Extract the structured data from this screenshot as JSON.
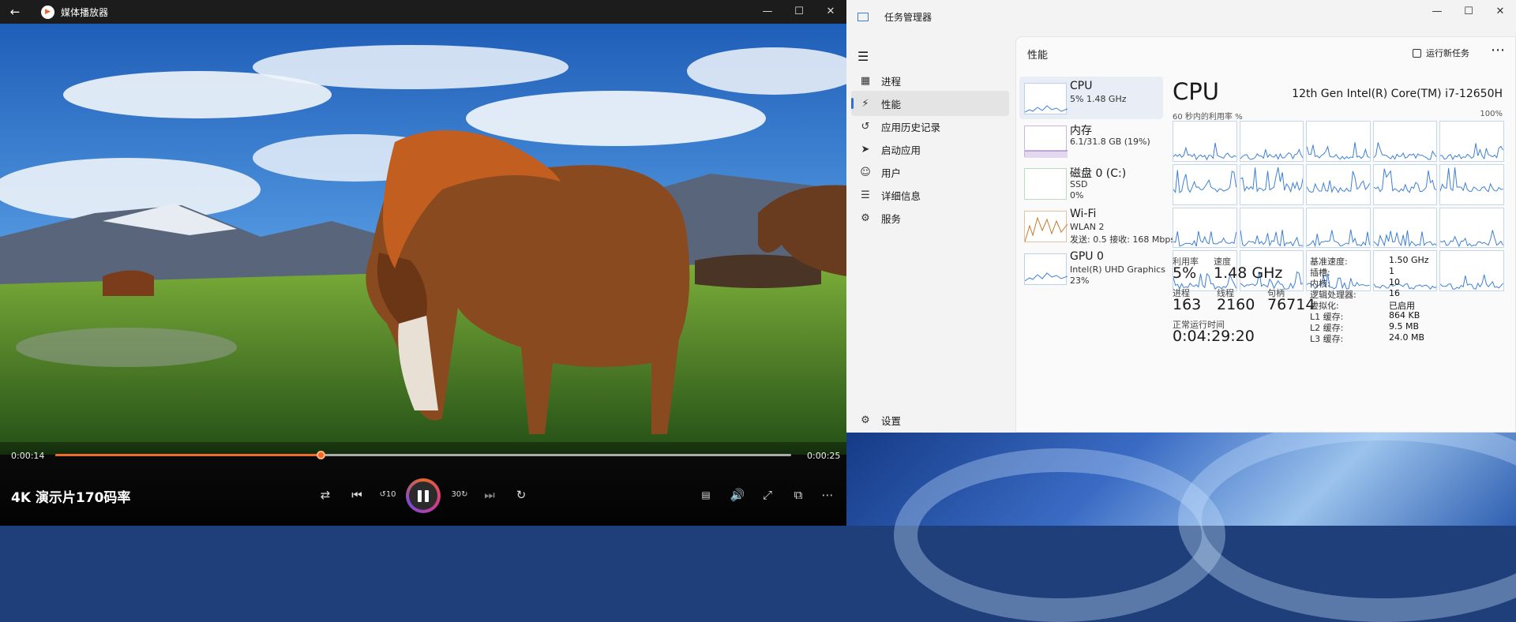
{
  "player": {
    "title": "媒体播放器",
    "current_time": "0:00:14",
    "total_time": "0:00:25",
    "progress": 0.36,
    "video_title": "4K 演示片170码率",
    "controls": [
      "shuffle-icon",
      "previous-icon",
      "rewind-10-icon",
      "pause-icon",
      "forward-30-icon",
      "next-icon",
      "repeat-off-icon",
      "subtitles-icon",
      "volume-icon",
      "fullscreen-icon",
      "mini-player-icon",
      "more-icon"
    ]
  },
  "taskmgr": {
    "title": "任务管理器",
    "nav": [
      {
        "label": "进程",
        "icon": "processes-icon"
      },
      {
        "label": "性能",
        "icon": "performance-icon"
      },
      {
        "label": "应用历史记录",
        "icon": "app-history-icon"
      },
      {
        "label": "启动应用",
        "icon": "startup-icon"
      },
      {
        "label": "用户",
        "icon": "users-icon"
      },
      {
        "label": "详细信息",
        "icon": "details-icon"
      },
      {
        "label": "服务",
        "icon": "services-icon"
      }
    ],
    "settings": "设置",
    "header": "性能",
    "run_task": "运行新任务",
    "devices": [
      {
        "name": "CPU",
        "line1": "5%  1.48 GHz",
        "line2": ""
      },
      {
        "name": "内存",
        "line1": "6.1/31.8 GB (19%)",
        "line2": ""
      },
      {
        "name": "磁盘 0 (C:)",
        "line1": "SSD",
        "line2": "0%"
      },
      {
        "name": "Wi-Fi",
        "line1": "WLAN 2",
        "line2": "发送: 0.5  接收: 168 Mbps"
      },
      {
        "name": "GPU 0",
        "line1": "Intel(R) UHD Graphics",
        "line2": "23%"
      }
    ],
    "cpu": {
      "heading": "CPU",
      "model": "12th Gen Intel(R) Core(TM) i7-12650H",
      "graph_label": "60 秒内的利用率 %",
      "graph_max": "100%",
      "util_label": "利用率",
      "util": "5%",
      "speed_label": "速度",
      "speed": "1.48 GHz",
      "proc_label": "进程",
      "proc": "163",
      "thread_label": "线程",
      "thread": "2160",
      "handle_label": "句柄",
      "handle": "76714",
      "uptime_label": "正常运行时间",
      "uptime": "0:04:29:20",
      "specs": [
        {
          "k": "基准速度:",
          "v": "1.50 GHz"
        },
        {
          "k": "插槽:",
          "v": "1"
        },
        {
          "k": "内核:",
          "v": "10"
        },
        {
          "k": "逻辑处理器:",
          "v": "16"
        },
        {
          "k": "虚拟化:",
          "v": "已启用"
        },
        {
          "k": "L1 缓存:",
          "v": "864 KB"
        },
        {
          "k": "L2 缓存:",
          "v": "9.5 MB"
        },
        {
          "k": "L3 缓存:",
          "v": "24.0 MB"
        }
      ]
    }
  },
  "colors": {
    "accent": "#f06a2a",
    "graph": "#3c7fd6",
    "wifi": "#c67a2b"
  }
}
